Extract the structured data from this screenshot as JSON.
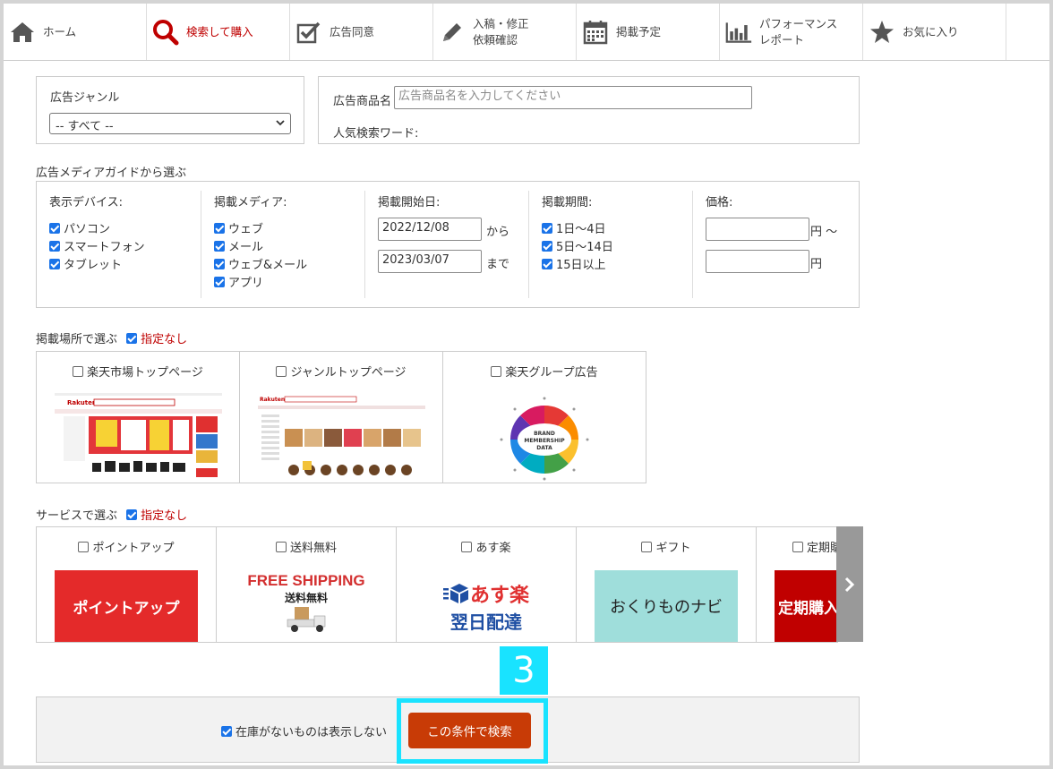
{
  "nav": {
    "items": [
      {
        "label": "ホーム",
        "icon": "home-icon"
      },
      {
        "label": "検索して購入",
        "icon": "search-icon",
        "active": true
      },
      {
        "label": "広告同意",
        "icon": "checkbox-icon"
      },
      {
        "label": "入稿・修正\n依頼確認",
        "icon": "pencil-icon"
      },
      {
        "label": "掲載予定",
        "icon": "calendar-icon"
      },
      {
        "label": "パフォーマンス\nレポート",
        "icon": "bar-chart-icon"
      },
      {
        "label": "お気に入り",
        "icon": "star-icon"
      }
    ]
  },
  "genre": {
    "label": "広告ジャンル",
    "selected": "-- すべて --"
  },
  "product": {
    "label": "広告商品名",
    "placeholder": "広告商品名を入力してください",
    "popular_label": "人気検索ワード:"
  },
  "media_guide": {
    "title": "広告メディアガイドから選ぶ",
    "device": {
      "title": "表示デバイス:",
      "options": [
        "パソコン",
        "スマートフォン",
        "タブレット"
      ]
    },
    "media": {
      "title": "掲載メディア:",
      "options": [
        "ウェブ",
        "メール",
        "ウェブ&メール",
        "アプリ"
      ]
    },
    "start": {
      "title": "掲載開始日:",
      "from": "2022/12/08",
      "from_suffix": "から",
      "to": "2023/03/07",
      "to_suffix": "まで"
    },
    "period": {
      "title": "掲載期間:",
      "options": [
        "1日～4日",
        "5日～14日",
        "15日以上"
      ]
    },
    "price": {
      "title": "価格:",
      "unit_from": "円 ～",
      "unit_to": "円"
    }
  },
  "placement": {
    "title": "掲載場所で選ぶ",
    "none_label": "指定なし",
    "items": [
      "楽天市場トップページ",
      "ジャンルトップページ",
      "楽天グループ広告"
    ],
    "wheel_text": [
      "BRAND",
      "MEMBERSHIP",
      "DATA"
    ],
    "logo_text": "Rakuten"
  },
  "service": {
    "title": "サービスで選ぶ",
    "none_label": "指定なし",
    "items": [
      "ポイントアップ",
      "送料無料",
      "あす楽",
      "ギフト",
      "定期購入"
    ],
    "banners": {
      "point_up": "ポイントアップ",
      "free_shipping_en": "FREE SHIPPING",
      "free_shipping_jp": "送料無料",
      "asuraku": "あす楽",
      "asuraku_sub": "翌日配達",
      "gift": "おくりものナビ",
      "teiki": "定期購入"
    }
  },
  "footer": {
    "stock_label": "在庫がないものは表示しない",
    "search_button": "この条件で検索",
    "step": "3"
  },
  "colors": {
    "accent_red": "#bf0000",
    "button": "#c83b06",
    "highlight": "#19e3ff",
    "checkbox": "#1a73e8"
  }
}
